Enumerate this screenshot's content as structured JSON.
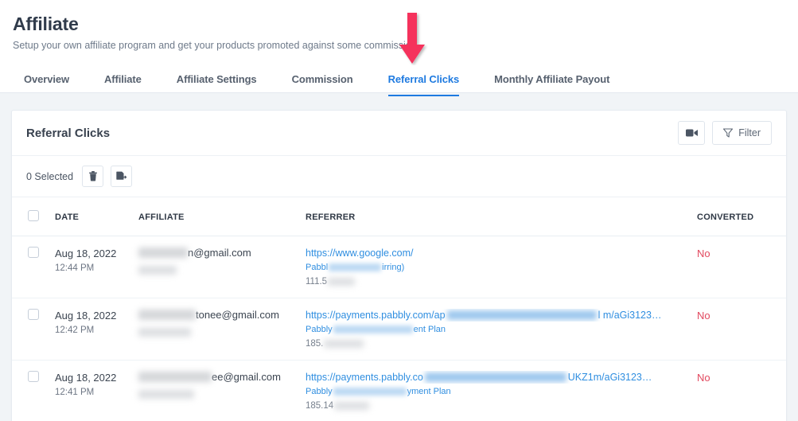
{
  "header": {
    "title": "Affiliate",
    "subtitle": "Setup your own affiliate program and get your products promoted against some commission.",
    "tabs": [
      {
        "label": "Overview",
        "active": false
      },
      {
        "label": "Affiliate",
        "active": false
      },
      {
        "label": "Affiliate Settings",
        "active": false
      },
      {
        "label": "Commission",
        "active": false
      },
      {
        "label": "Referral Clicks",
        "active": true
      },
      {
        "label": "Monthly Affiliate Payout",
        "active": false
      }
    ],
    "active_tab": "Referral Clicks"
  },
  "annotation": {
    "type": "arrow-down",
    "color": "#f5325c",
    "points_at": "Referral Clicks"
  },
  "card": {
    "title": "Referral Clicks",
    "actions": {
      "video_icon": "video-camera-icon",
      "filter_label": "Filter",
      "filter_icon": "funnel-icon"
    },
    "selection_bar": {
      "count_label": "0 Selected",
      "delete_icon": "trash-icon",
      "export_icon": "file-export-icon"
    },
    "table": {
      "columns": [
        "DATE",
        "AFFILIATE",
        "REFERRER",
        "CONVERTED"
      ],
      "rows": [
        {
          "date": "Aug 18, 2022",
          "time": "12:44 PM",
          "affiliate_email_suffix": "n@gmail.com",
          "referrer_url": "https://www.google.com/",
          "referrer_sub_prefix": "Pabbl",
          "referrer_sub_suffix": "irring)",
          "ip_prefix": "111.5",
          "converted": "No"
        },
        {
          "date": "Aug 18, 2022",
          "time": "12:42 PM",
          "affiliate_email_suffix": "tonee@gmail.com",
          "referrer_url_prefix": "https://payments.pabbly.com/ap",
          "referrer_url_suffix": "l m/aGi3123…",
          "referrer_sub_prefix": "Pabbly",
          "referrer_sub_suffix": "ent Plan",
          "ip_prefix": "185.",
          "converted": "No"
        },
        {
          "date": "Aug 18, 2022",
          "time": "12:41 PM",
          "affiliate_email_suffix": "ee@gmail.com",
          "referrer_url_prefix": "https://payments.pabbly.co",
          "referrer_url_suffix": "UKZ1m/aGi3123…",
          "referrer_sub_prefix": "Pabbly",
          "referrer_sub_suffix": "yment Plan",
          "ip_prefix": "185.14",
          "converted": "No"
        }
      ]
    }
  },
  "colors": {
    "accent_blue": "#1e7ae0",
    "link_blue": "#2f8ee0",
    "danger_red": "#e2495f",
    "annotation_pink": "#f5325c",
    "page_bg": "#f1f4f7"
  }
}
